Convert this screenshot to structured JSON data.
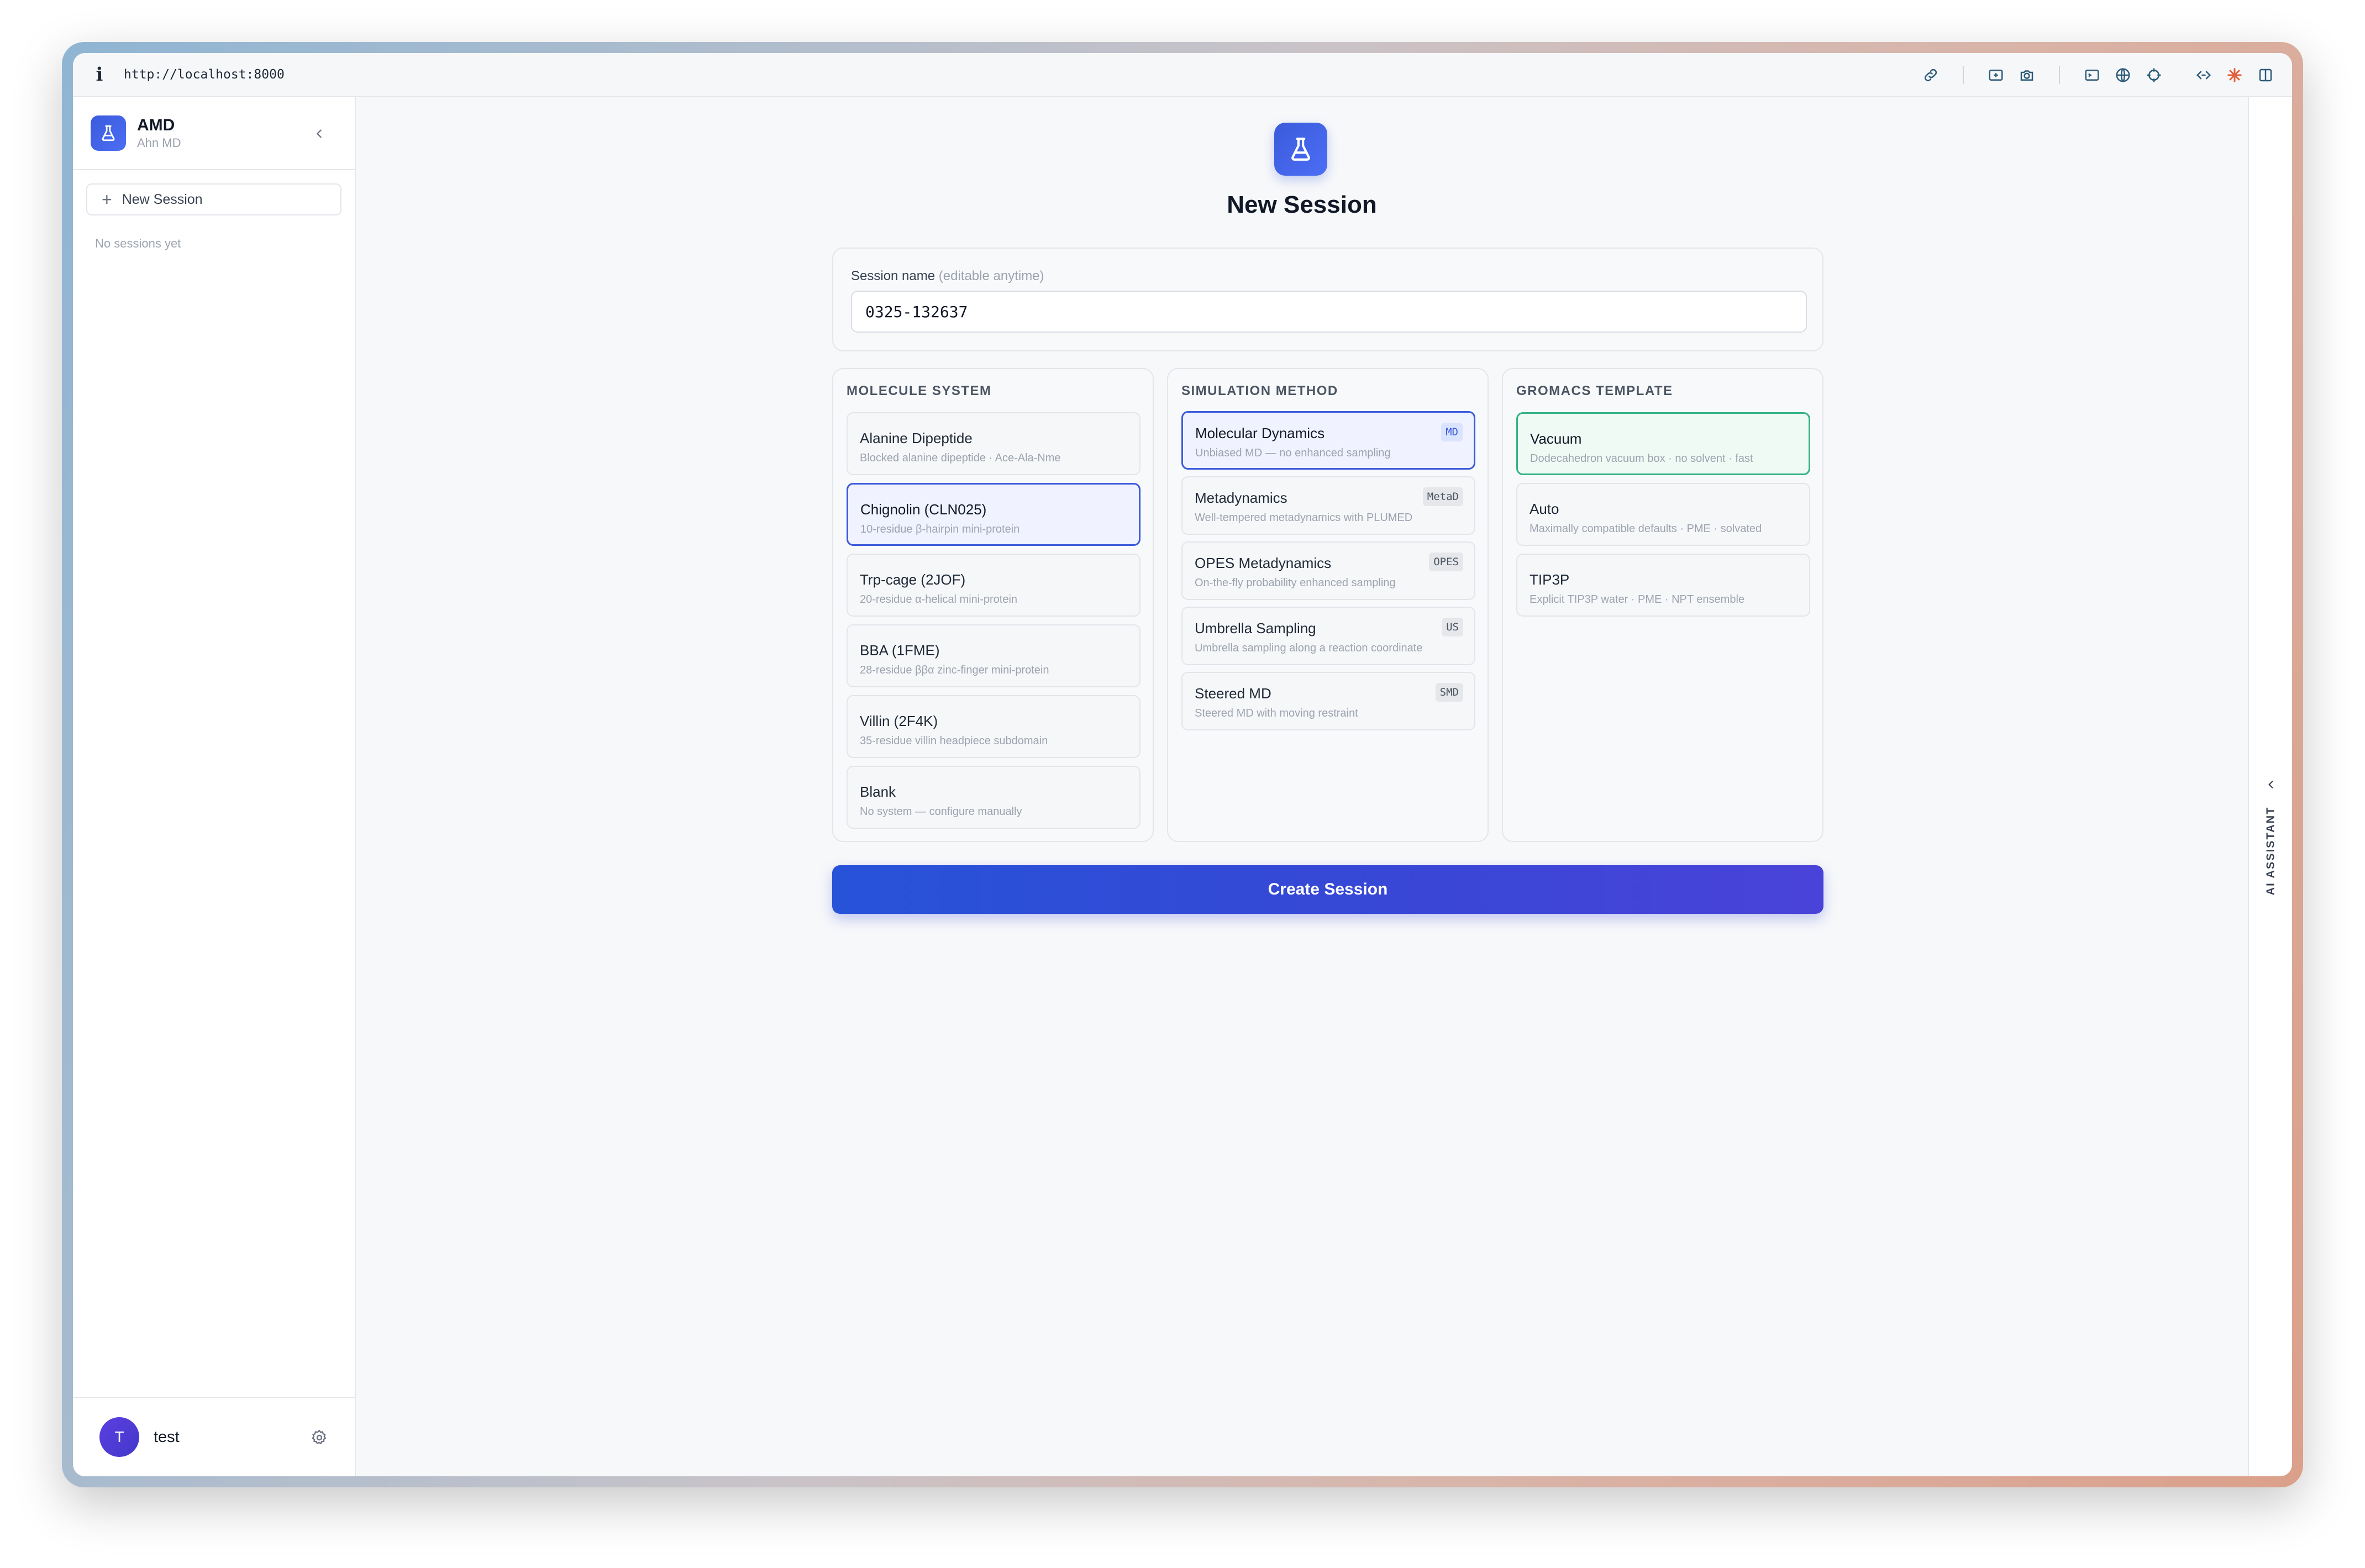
{
  "browser": {
    "url": "http://localhost:8000"
  },
  "sidebar": {
    "brand_name": "AMD",
    "brand_sub": "Ahn MD",
    "new_session_label": "New Session",
    "empty_text": "No sessions yet",
    "user": {
      "initial": "T",
      "name": "test"
    }
  },
  "ai_panel": {
    "label": "AI ASSISTANT"
  },
  "main": {
    "title": "New Session",
    "session_name": {
      "label": "Session name",
      "hint": "(editable anytime)",
      "value": "0325-132637"
    },
    "molecule": {
      "title": "MOLECULE SYSTEM",
      "selected": "Chignolin (CLN025)",
      "options": [
        {
          "name": "Alanine Dipeptide",
          "desc": "Blocked alanine dipeptide · Ace-Ala-Nme"
        },
        {
          "name": "Chignolin (CLN025)",
          "desc": "10-residue β-hairpin mini-protein"
        },
        {
          "name": "Trp-cage (2JOF)",
          "desc": "20-residue α-helical mini-protein"
        },
        {
          "name": "BBA (1FME)",
          "desc": "28-residue ββα zinc-finger mini-protein"
        },
        {
          "name": "Villin (2F4K)",
          "desc": "35-residue villin headpiece subdomain"
        },
        {
          "name": "Blank",
          "desc": "No system — configure manually"
        }
      ]
    },
    "method": {
      "title": "SIMULATION METHOD",
      "selected": "Molecular Dynamics",
      "options": [
        {
          "name": "Molecular Dynamics",
          "desc": "Unbiased MD — no enhanced sampling",
          "badge": "MD"
        },
        {
          "name": "Metadynamics",
          "desc": "Well-tempered metadynamics with PLUMED",
          "badge": "MetaD"
        },
        {
          "name": "OPES Metadynamics",
          "desc": "On-the-fly probability enhanced sampling",
          "badge": "OPES"
        },
        {
          "name": "Umbrella Sampling",
          "desc": "Umbrella sampling along a reaction coordinate",
          "badge": "US"
        },
        {
          "name": "Steered MD",
          "desc": "Steered MD with moving restraint",
          "badge": "SMD"
        }
      ]
    },
    "template": {
      "title": "GROMACS TEMPLATE",
      "selected": "Vacuum",
      "options": [
        {
          "name": "Vacuum",
          "desc": "Dodecahedron vacuum box · no solvent · fast"
        },
        {
          "name": "Auto",
          "desc": "Maximally compatible defaults · PME · solvated"
        },
        {
          "name": "TIP3P",
          "desc": "Explicit TIP3P water · PME · NPT ensemble"
        }
      ]
    },
    "create_button": "Create Session"
  },
  "colors": {
    "accent": "#3b5bdb",
    "selected_green": "#34b385",
    "button_gradient_start": "#2753d9",
    "button_gradient_end": "#4a43d9"
  }
}
